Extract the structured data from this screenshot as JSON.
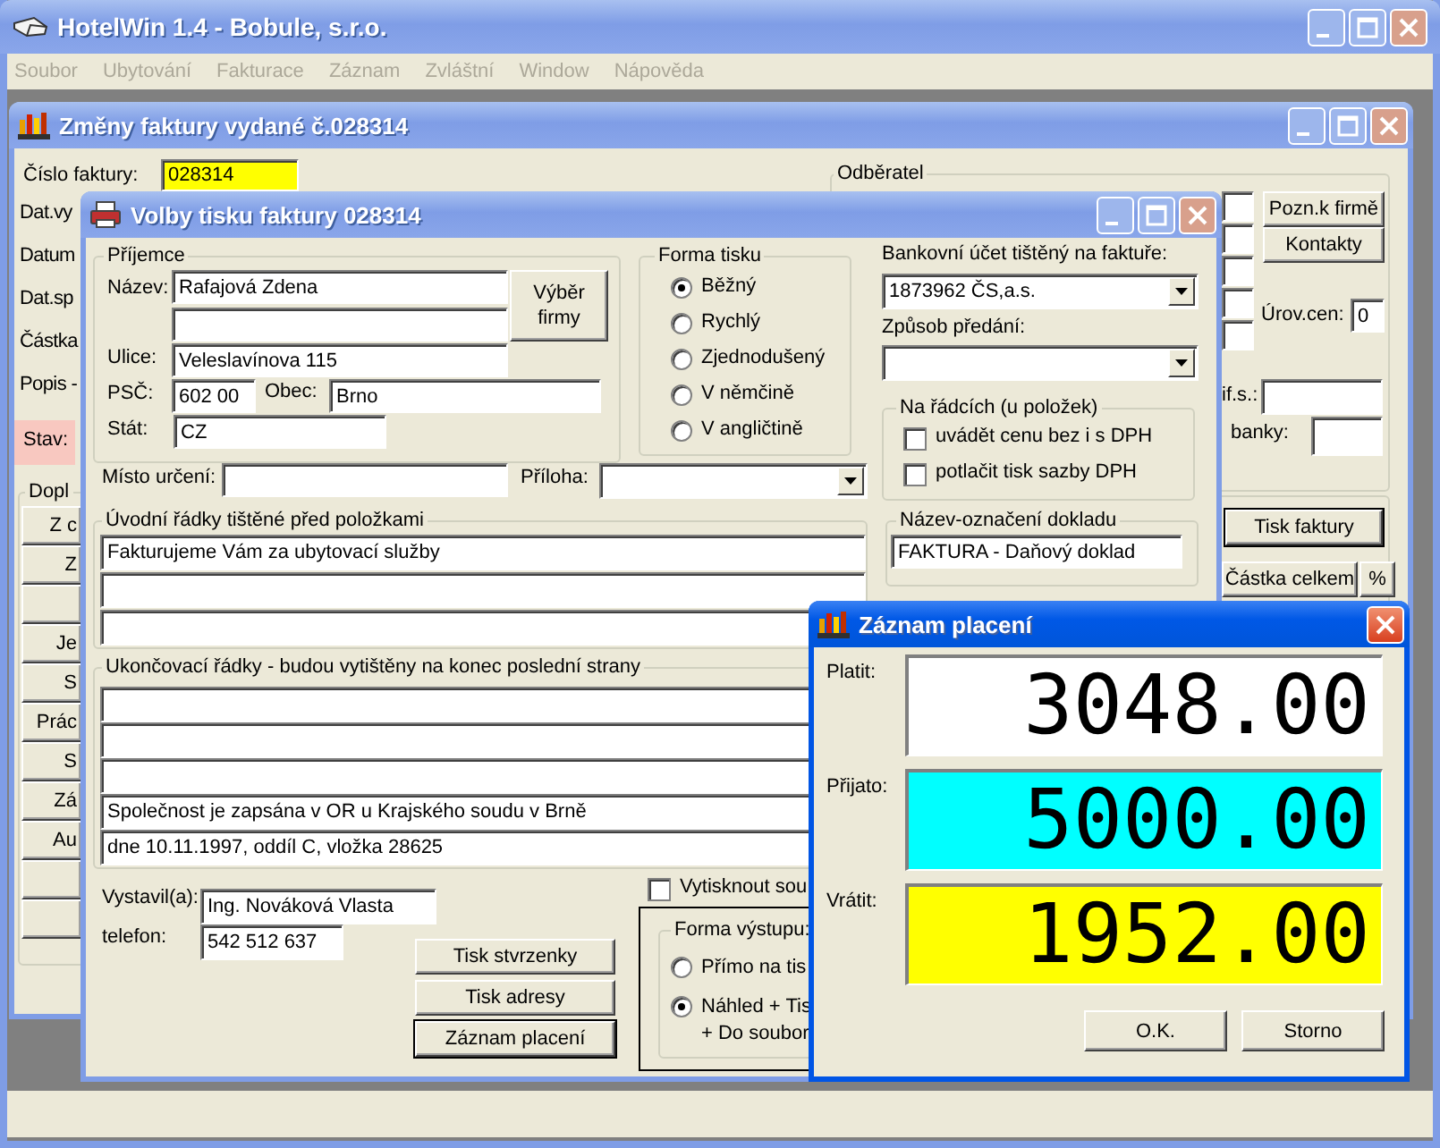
{
  "app": {
    "title": "HotelWin 1.4 - Bobule, s.r.o.",
    "menu": [
      {
        "label": "Soubor",
        "disabled": true
      },
      {
        "label": "Ubytování",
        "disabled": true
      },
      {
        "label": "Fakturace",
        "disabled": true
      },
      {
        "label": "Záznam",
        "disabled": true
      },
      {
        "label": "Zvláštní",
        "disabled": true
      },
      {
        "label": "Window",
        "disabled": true
      },
      {
        "label": "Nápověda",
        "disabled": true
      }
    ]
  },
  "invoice_window": {
    "title": "Změny faktury vydané č.028314",
    "invoice_number": {
      "label": "Číslo faktury:",
      "value": "028314"
    },
    "row_labels": [
      "Dat.vy",
      "Datum",
      "Dat.sp",
      "Částka",
      "Popis -"
    ],
    "status_label": "Stav:",
    "extras_legend": "Dopl",
    "side_buttons": [
      {
        "kind": "text",
        "label": "Z c"
      },
      {
        "kind": "text",
        "label": "Z"
      },
      {
        "kind": "blank"
      },
      {
        "kind": "text",
        "label": "Je"
      },
      {
        "kind": "text",
        "label": "S"
      },
      {
        "kind": "text",
        "label": "Prác"
      },
      {
        "kind": "text",
        "label": "S"
      },
      {
        "kind": "text",
        "label": "Zá"
      },
      {
        "kind": "text",
        "label": "Au"
      },
      {
        "kind": "blank"
      },
      {
        "kind": "blank"
      }
    ],
    "customer_legend": "Odběratel",
    "note_button": "Pozn.k firmě",
    "contacts_button": "Kontakty",
    "price_level": {
      "label": "Úrov.cen:",
      "value": "0"
    },
    "class_label": "if.s.:",
    "bank_label": "banky:",
    "print_button": "Tisk faktury",
    "total_button": "Částka celkem",
    "percent_button": "%"
  },
  "print_dialog": {
    "title": "Volby tisku faktury 028314",
    "recipient": {
      "legend": "Příjemce",
      "name_label": "Název:",
      "name": "Rafajová Zdena",
      "street_label": "Ulice:",
      "street": "Veleslavínova 115",
      "zip_label": "PSČ:",
      "zip": "602 00",
      "city_label": "Obec:",
      "city": "Brno",
      "country_label": "Stát:",
      "country": "CZ",
      "pick_button": "Výběr firmy"
    },
    "print_form": {
      "legend": "Forma tisku",
      "options": [
        {
          "label": "Běžný",
          "selected": true
        },
        {
          "label": "Rychlý",
          "selected": false
        },
        {
          "label": "Zjednodušený",
          "selected": false
        },
        {
          "label": "V němčině",
          "selected": false
        },
        {
          "label": "V angličtině",
          "selected": false
        }
      ]
    },
    "bank_account": {
      "label": "Bankovní účet tištěný na faktuře:",
      "value": "1873962 ČS,a.s."
    },
    "delivery": {
      "label": "Způsob předání:"
    },
    "line_options": {
      "legend": "Na řádcích (u položek)",
      "items": [
        {
          "label": "uvádět cenu bez i s DPH",
          "checked": false
        },
        {
          "label": "potlačit tisk sazby DPH",
          "checked": false
        }
      ]
    },
    "destination_label": "Místo určení:",
    "attachment_label": "Příloha:",
    "intro_lines": {
      "legend": "Úvodní řádky tištěné před položkami",
      "lines": [
        {
          "kind": "text",
          "text": "Fakturujeme Vám za ubytovací služby"
        },
        {
          "kind": "blank"
        },
        {
          "kind": "blank"
        }
      ]
    },
    "document_name": {
      "legend": "Název-označení dokladu",
      "value": "FAKTURA - Daňový doklad"
    },
    "closing_lines": {
      "legend": "Ukončovací řádky - budou vytištěny na konec poslední strany",
      "lines": [
        {
          "kind": "blank"
        },
        {
          "kind": "blank"
        },
        {
          "kind": "blank"
        },
        {
          "kind": "text",
          "text": "Společnost je zapsána v OR u Krajského soudu v Brně"
        },
        {
          "kind": "text",
          "text": "dne 10.11.1997, oddíl C, vložka 28625"
        }
      ]
    },
    "issued_by": {
      "label": "Vystavil(a):",
      "value": "Ing. Nováková Vlasta"
    },
    "phone": {
      "label": "telefon:",
      "value": "542 512 637"
    },
    "buttons": [
      {
        "label": "Tisk stvrzenky",
        "default": false
      },
      {
        "label": "Tisk adresy",
        "default": false
      },
      {
        "label": "Záznam placení",
        "default": true
      }
    ],
    "print_summary": {
      "label": "Vytisknout sou",
      "checked": false
    },
    "output_form": {
      "legend": "Forma výstupu:",
      "options": [
        {
          "lines": [
            "Přímo na tis"
          ],
          "selected": false
        },
        {
          "lines": [
            "Náhled + Tis",
            "+ Do soubor"
          ],
          "selected": true
        }
      ]
    }
  },
  "payment_dialog": {
    "title": "Záznam placení",
    "rows": [
      {
        "label": "Platit:",
        "value": "3048.00",
        "color": "#ffffff"
      },
      {
        "label": "Přijato:",
        "value": "5000.00",
        "color": "#00ffff"
      },
      {
        "label": "Vrátit:",
        "value": "1952.00",
        "color": "#ffff00"
      }
    ],
    "ok_button": "O.K.",
    "cancel_button": "Storno"
  }
}
